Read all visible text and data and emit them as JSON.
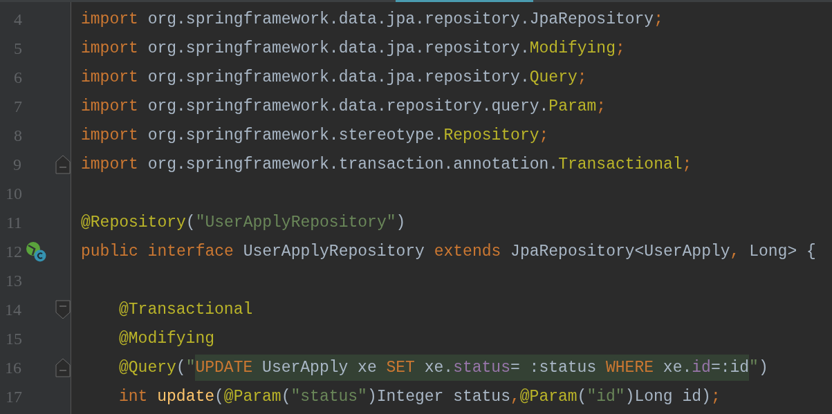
{
  "editor": {
    "lines": [
      {
        "number": "4",
        "indented": false,
        "tokens": [
          {
            "kind": "keyword",
            "text": "import "
          },
          {
            "kind": "plain",
            "text": "org.springframework.data.jpa.repository.JpaRepository"
          },
          {
            "kind": "keyword",
            "text": ";"
          }
        ]
      },
      {
        "number": "5",
        "indented": false,
        "tokens": [
          {
            "kind": "keyword",
            "text": "import "
          },
          {
            "kind": "plain",
            "text": "org.springframework.data.jpa.repository."
          },
          {
            "kind": "annotation",
            "text": "Modifying"
          },
          {
            "kind": "keyword",
            "text": ";"
          }
        ]
      },
      {
        "number": "6",
        "indented": false,
        "tokens": [
          {
            "kind": "keyword",
            "text": "import "
          },
          {
            "kind": "plain",
            "text": "org.springframework.data.jpa.repository."
          },
          {
            "kind": "annotation",
            "text": "Query"
          },
          {
            "kind": "keyword",
            "text": ";"
          }
        ]
      },
      {
        "number": "7",
        "indented": false,
        "tokens": [
          {
            "kind": "keyword",
            "text": "import "
          },
          {
            "kind": "plain",
            "text": "org.springframework.data.repository.query."
          },
          {
            "kind": "annotation",
            "text": "Param"
          },
          {
            "kind": "keyword",
            "text": ";"
          }
        ]
      },
      {
        "number": "8",
        "indented": false,
        "tokens": [
          {
            "kind": "keyword",
            "text": "import "
          },
          {
            "kind": "plain",
            "text": "org.springframework.stereotype."
          },
          {
            "kind": "annotation",
            "text": "Repository"
          },
          {
            "kind": "keyword",
            "text": ";"
          }
        ]
      },
      {
        "number": "9",
        "indented": false,
        "fold_marker": {
          "kind": "end"
        },
        "tokens": [
          {
            "kind": "keyword",
            "text": "import "
          },
          {
            "kind": "plain",
            "text": "org.springframework.transaction.annotation."
          },
          {
            "kind": "annotation",
            "text": "Transactional"
          },
          {
            "kind": "keyword",
            "text": ";"
          }
        ]
      },
      {
        "number": "10",
        "indented": false
      },
      {
        "number": "11",
        "indented": false,
        "tokens": [
          {
            "kind": "annotation",
            "text": "@Repository"
          },
          {
            "kind": "plain",
            "text": "("
          },
          {
            "kind": "string",
            "text": "\"UserApplyRepository\""
          },
          {
            "kind": "plain",
            "text": ")"
          }
        ]
      },
      {
        "number": "12",
        "indented": false,
        "gutter_icon": {
          "kind": "implemented"
        },
        "tokens": [
          {
            "kind": "keyword",
            "text": "public interface "
          },
          {
            "kind": "plain",
            "text": "UserApplyRepository "
          },
          {
            "kind": "keyword",
            "text": "extends "
          },
          {
            "kind": "plain",
            "text": "JpaRepository<UserApply"
          },
          {
            "kind": "keyword",
            "text": ", "
          },
          {
            "kind": "plain",
            "text": "Long> {"
          }
        ]
      },
      {
        "number": "13",
        "indented": false
      },
      {
        "number": "14",
        "indented": true,
        "fold_marker": {
          "kind": "start"
        },
        "tokens": [
          {
            "kind": "annotation",
            "text": "@Transactional"
          }
        ]
      },
      {
        "number": "15",
        "indented": true,
        "tokens": [
          {
            "kind": "annotation",
            "text": "@Modifying"
          }
        ]
      },
      {
        "number": "16",
        "indented": true,
        "fold_marker": {
          "kind": "end"
        },
        "tokens": [
          {
            "kind": "annotation",
            "text": "@Query"
          },
          {
            "kind": "plain",
            "text": "("
          },
          {
            "kind": "string",
            "text": "\""
          },
          {
            "kind": "injected",
            "parts": [
              {
                "kind": "sql-keyword",
                "text": "UPDATE "
              },
              {
                "kind": "plain",
                "text": "UserApply xe "
              },
              {
                "kind": "sql-keyword",
                "text": "SET "
              },
              {
                "kind": "plain",
                "text": "xe."
              },
              {
                "kind": "field",
                "text": "status"
              },
              {
                "kind": "plain",
                "text": "= :status "
              },
              {
                "kind": "sql-keyword",
                "text": "WHERE "
              },
              {
                "kind": "plain",
                "text": "xe."
              },
              {
                "kind": "field",
                "text": "id"
              },
              {
                "kind": "plain",
                "text": "=:id"
              }
            ]
          },
          {
            "kind": "string",
            "text": "\""
          },
          {
            "kind": "plain",
            "text": ")"
          }
        ]
      },
      {
        "number": "17",
        "indented": true,
        "tokens": [
          {
            "kind": "keyword",
            "text": "int "
          },
          {
            "kind": "method",
            "text": "update"
          },
          {
            "kind": "plain",
            "text": "("
          },
          {
            "kind": "annotation",
            "text": "@Param"
          },
          {
            "kind": "plain",
            "text": "("
          },
          {
            "kind": "string",
            "text": "\"status\""
          },
          {
            "kind": "plain",
            "text": ")Integer status"
          },
          {
            "kind": "keyword",
            "text": ","
          },
          {
            "kind": "annotation",
            "text": "@Param"
          },
          {
            "kind": "plain",
            "text": "("
          },
          {
            "kind": "string",
            "text": "\"id\""
          },
          {
            "kind": "plain",
            "text": ")Long id)"
          },
          {
            "kind": "keyword",
            "text": ";"
          }
        ]
      }
    ]
  }
}
